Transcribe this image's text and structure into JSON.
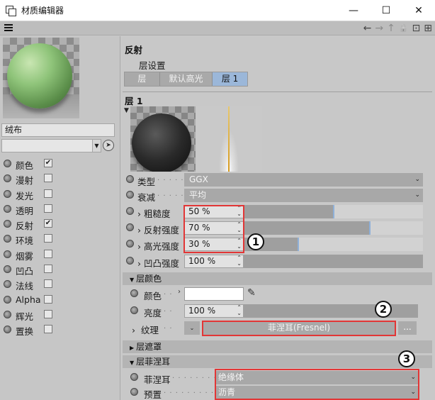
{
  "window": {
    "title": "材质编辑器",
    "minimize": "—",
    "maximize": "☐",
    "close": "✕"
  },
  "toolbar": {
    "back_icon": "←",
    "forward_icon": "→",
    "up_icon": "↑",
    "lock_icon": "🔒",
    "new_icon": "⊡",
    "pin_icon": "⊞"
  },
  "left_panel": {
    "material_name": "绒布",
    "channels": [
      {
        "label": "颜色",
        "checked": true
      },
      {
        "label": "漫射",
        "checked": false
      },
      {
        "label": "发光",
        "checked": false
      },
      {
        "label": "透明",
        "checked": false
      },
      {
        "label": "反射",
        "checked": true
      },
      {
        "label": "环境",
        "checked": false
      },
      {
        "label": "烟雾",
        "checked": false
      },
      {
        "label": "凹凸",
        "checked": false
      },
      {
        "label": "法线",
        "checked": false
      },
      {
        "label": "Alpha",
        "checked": false
      },
      {
        "label": "辉光",
        "checked": false
      },
      {
        "label": "置换",
        "checked": false
      }
    ]
  },
  "reflect": {
    "section_title": "反射",
    "layer_settings_label": "层设置",
    "tabs": [
      {
        "label": "层",
        "active": false
      },
      {
        "label": "默认高光",
        "active": false
      },
      {
        "label": "层 1",
        "active": true
      }
    ],
    "layer_title": "层 1",
    "type": {
      "label": "类型",
      "value": "GGX"
    },
    "attenuation": {
      "label": "衰减",
      "value": "平均"
    },
    "roughness": {
      "label": "粗糙度",
      "value": "50 %",
      "level": 0.5
    },
    "reflect_strength": {
      "label": "反射强度",
      "value": "70 %",
      "level": 0.7
    },
    "specular_strength": {
      "label": "高光强度",
      "value": "30 %",
      "level": 0.3
    },
    "bump_strength": {
      "label": "凹凸强度",
      "value": "100 %",
      "level": 1.0
    }
  },
  "layer_color": {
    "group_title": "层颜色",
    "color_label": "颜色",
    "brightness": {
      "label": "亮度",
      "value": "100 %",
      "level": 1.0
    },
    "texture": {
      "label": "纹理",
      "value": "菲涅耳(Fresnel)",
      "more": "..."
    }
  },
  "layer_mask": {
    "group_title": "层遮罩"
  },
  "layer_fresnel": {
    "group_title": "层菲涅耳",
    "fresnel": {
      "label": "菲涅耳",
      "value": "绝缘体"
    },
    "preset": {
      "label": "预置",
      "value": "沥青"
    }
  },
  "annotations": [
    "1",
    "2",
    "3"
  ],
  "colors": {
    "panel": "#c8c8c8",
    "active_tab": "#9bb7d9",
    "highlight_box": "#e23636",
    "graph_line": "#d79b1f"
  }
}
